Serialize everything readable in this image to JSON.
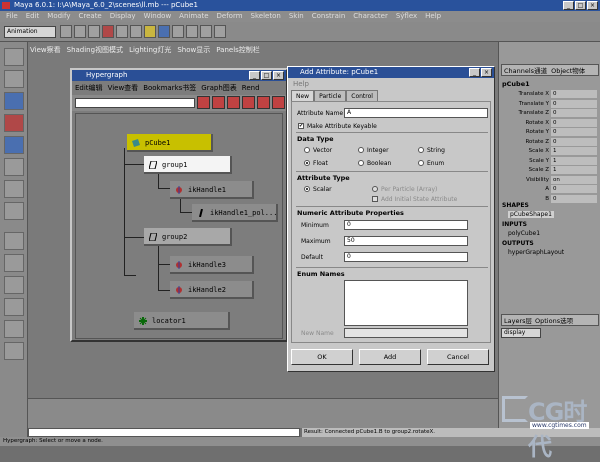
{
  "window": {
    "title": "Maya 6.0.1: I:\\A\\Maya_6.0_2\\scenes\\ll.mb  ---  pCube1",
    "minimize": "_",
    "maximize": "□",
    "close": "×"
  },
  "menubar": [
    "File",
    "Edit",
    "Modify",
    "Create",
    "Display",
    "Window",
    "Animate",
    "Deform",
    "Skeleton",
    "Skin",
    "Constrain",
    "Character",
    "Sýflex",
    "Help"
  ],
  "toolbar": {
    "mode": "Animation"
  },
  "panel_menu": [
    "View察看",
    "Shading视图模式",
    "Lighting灯光",
    "Show显示",
    "Panels控制栏"
  ],
  "hypergraph": {
    "title": "Hypergraph",
    "menu": [
      "Edit编辑",
      "View查看",
      "Bookmarks书签",
      "Graph图表",
      "Rend"
    ],
    "nodes": [
      {
        "label": "pCube1"
      },
      {
        "label": "group1"
      },
      {
        "label": "ikHandle1"
      },
      {
        "label": "ikHandle1_pol..."
      },
      {
        "label": "group2"
      },
      {
        "label": "ikHandle3"
      },
      {
        "label": "ikHandle2"
      },
      {
        "label": "locator1"
      }
    ]
  },
  "add_attribute": {
    "title": "Add Attribute: pCube1",
    "help": "Help",
    "tabs": [
      "New",
      "Particle",
      "Control"
    ],
    "attribute_name_label": "Attribute Name",
    "attribute_name_value": "A",
    "make_keyable": "Make Attribute Keyable",
    "data_type_header": "Data Type",
    "data_types": [
      "Vector",
      "Integer",
      "String",
      "Float",
      "Boolean",
      "Enum"
    ],
    "attribute_type_header": "Attribute Type",
    "scalar": "Scalar",
    "per_particle": "Per Particle (Array)",
    "add_initial": "Add Initial State Attribute",
    "numeric_header": "Numeric Attribute Properties",
    "minimum_label": "Minimum",
    "minimum_value": "0",
    "maximum_label": "Maximum",
    "maximum_value": "50",
    "default_label": "Default",
    "default_value": "0",
    "enum_header": "Enum Names",
    "new_name_label": "New Name",
    "ok": "OK",
    "add": "Add",
    "cancel": "Cancel"
  },
  "channel_box": {
    "header": [
      "Channels通道",
      "Object物体"
    ],
    "object": "pCube1",
    "channels": [
      {
        "name": "Translate X",
        "value": "0"
      },
      {
        "name": "Translate Y",
        "value": "0"
      },
      {
        "name": "Translate Z",
        "value": "0"
      },
      {
        "name": "Rotate X",
        "value": "0"
      },
      {
        "name": "Rotate Y",
        "value": "0"
      },
      {
        "name": "Rotate Z",
        "value": "0"
      },
      {
        "name": "Scale X",
        "value": "1"
      },
      {
        "name": "Scale Y",
        "value": "1"
      },
      {
        "name": "Scale Z",
        "value": "1"
      },
      {
        "name": "Visibility",
        "value": "on"
      },
      {
        "name": "A",
        "value": "0"
      },
      {
        "name": "B",
        "value": "0"
      }
    ],
    "shapes_header": "SHAPES",
    "shape": "pCubeShape1",
    "inputs_header": "INPUTS",
    "input": "polyCube1",
    "outputs_header": "OUTPUTS",
    "output": "hyperGraphLayout",
    "layers_header": [
      "Layers层",
      "Options选项"
    ],
    "layer_mode": "display"
  },
  "status": {
    "result": "Result: Connected pCube1.B to group2.rotateX.",
    "help": "Hypergraph: Select or move a node."
  },
  "watermark": {
    "brand": "CG时代",
    "url": "www.cgtimes.com"
  },
  "colors": {
    "titlebar": "#29529c",
    "selected_node": "#c8c000",
    "dialog_bg": "#c8c8c8"
  }
}
